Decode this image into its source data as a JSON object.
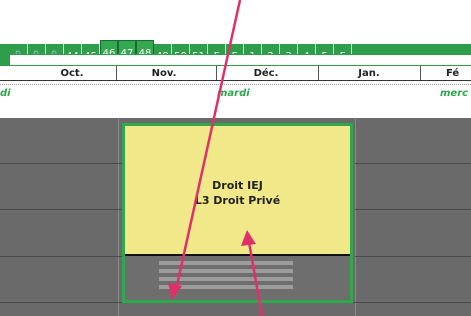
{
  "weeks": [
    {
      "label": "🔒",
      "name": "week-locked-1",
      "style": "ldr"
    },
    {
      "label": "🔒",
      "name": "week-locked-2",
      "style": "ldr"
    },
    {
      "label": "🔒",
      "name": "week-locked-3",
      "style": "ldr"
    },
    {
      "label": "44",
      "name": "week-44",
      "style": "link"
    },
    {
      "label": "45",
      "name": "week-45",
      "style": "link"
    },
    {
      "label": "46",
      "name": "week-46",
      "style": "link tall"
    },
    {
      "label": "47",
      "name": "week-47",
      "style": "link tall"
    },
    {
      "label": "48",
      "name": "week-48",
      "style": "link tall"
    },
    {
      "label": "49",
      "name": "week-49",
      "style": "link"
    },
    {
      "label": "50",
      "name": "week-50",
      "style": "link"
    },
    {
      "label": "51",
      "name": "week-51",
      "style": "link"
    },
    {
      "label": "F",
      "name": "week-holiday-1",
      "style": ""
    },
    {
      "label": "F",
      "name": "week-holiday-2",
      "style": ""
    },
    {
      "label": "1",
      "name": "week-1",
      "style": ""
    },
    {
      "label": "2",
      "name": "week-2",
      "style": ""
    },
    {
      "label": "3",
      "name": "week-3",
      "style": ""
    },
    {
      "label": "4",
      "name": "week-4",
      "style": ""
    },
    {
      "label": "5",
      "name": "week-5",
      "style": ""
    },
    {
      "label": "F",
      "name": "week-holiday-3",
      "style": "link"
    }
  ],
  "months": [
    "Oct.",
    "Nov.",
    "Déc.",
    "Jan.",
    "Fé"
  ],
  "days": {
    "left": "di",
    "center": "mardi",
    "right": "merc"
  },
  "course": {
    "line1": "Droit IEJ",
    "line2": "L3 Droit Privé"
  },
  "colors": {
    "accent": "#2fa74b",
    "card": "#f1e88a",
    "arrow": "#e0306a"
  }
}
